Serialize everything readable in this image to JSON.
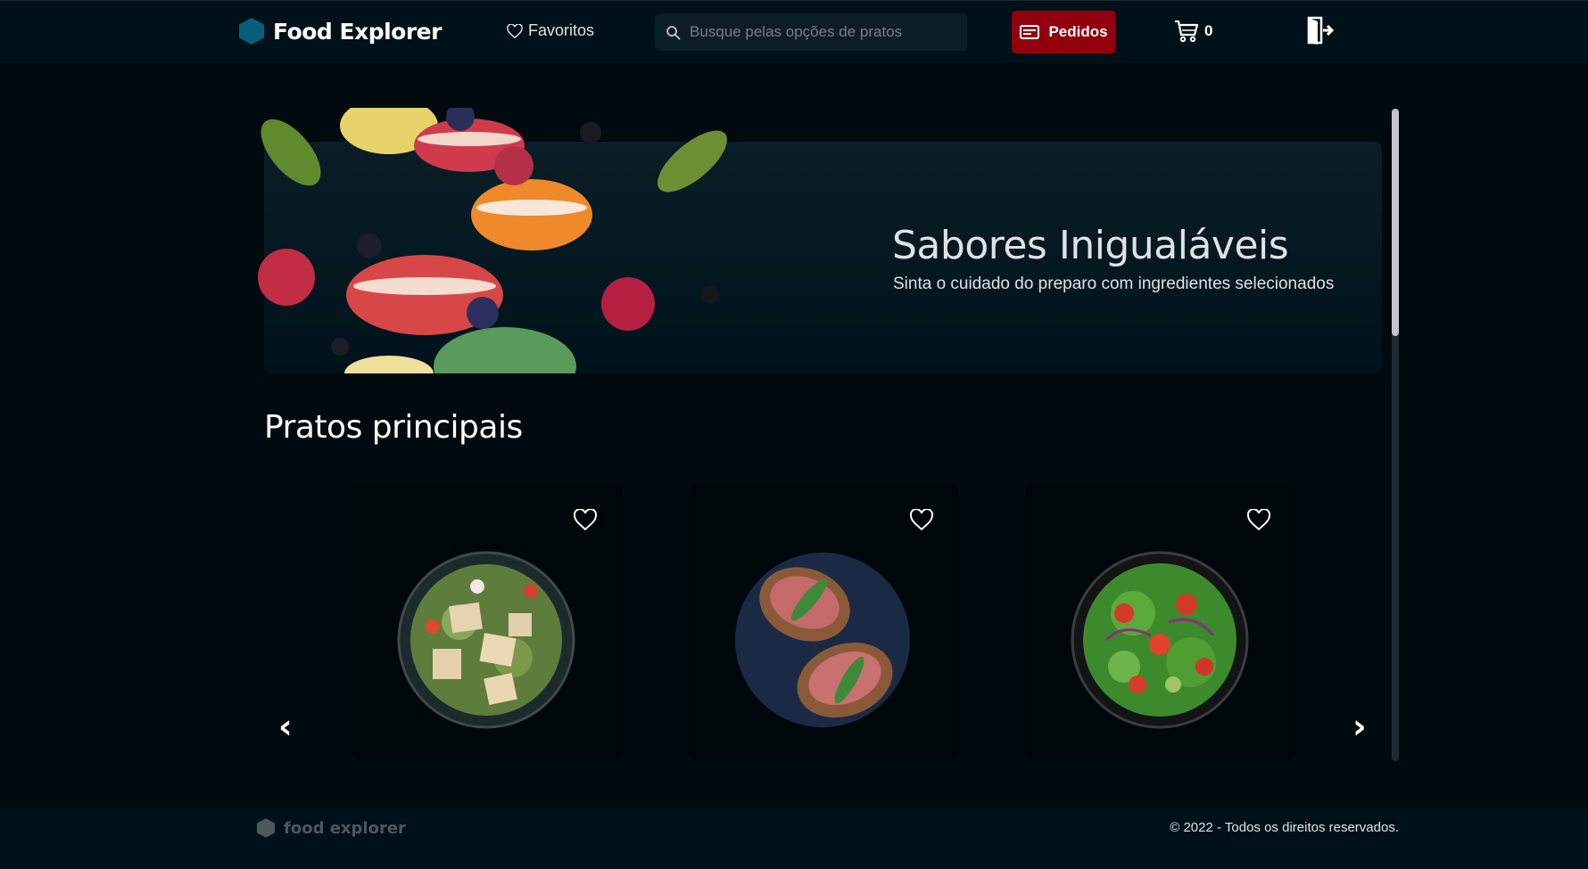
{
  "header": {
    "brand": "Food Explorer",
    "favorites_label": "Favoritos",
    "search_placeholder": "Busque pelas opções de pratos",
    "orders_label": "Pedidos",
    "cart_count": "0"
  },
  "banner": {
    "title": "Sabores Inigualáveis",
    "subtitle": "Sinta o cuidado do preparo com ingredientes selecionados"
  },
  "section": {
    "title": "Pratos principais",
    "prev_arrow": "‹",
    "next_arrow": "›"
  },
  "dishes": [
    {
      "icon": "caesar-salad-image"
    },
    {
      "icon": "bruschetta-image"
    },
    {
      "icon": "green-salad-image"
    }
  ],
  "footer": {
    "brand": "food explorer",
    "copyright": "© 2022 - Todos os direitos reservados."
  },
  "colors": {
    "brand_hex": "#065e7c",
    "orders_button": "#92000e",
    "background": "#000a0f",
    "header_bg": "#00111a"
  }
}
